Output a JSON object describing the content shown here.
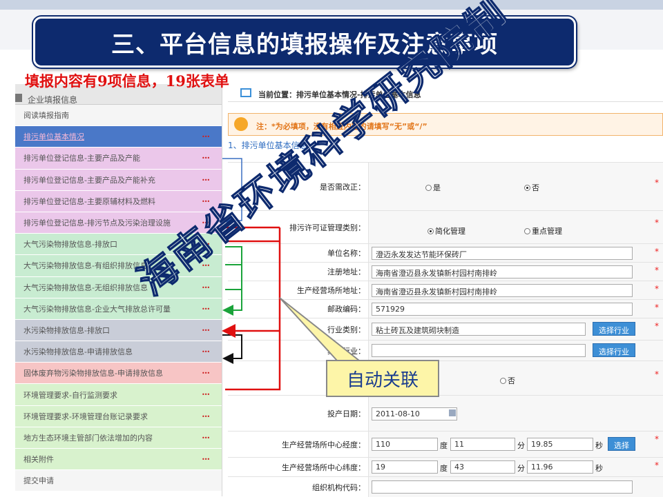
{
  "slide": {
    "title": "三、平台信息的填报操作及注意事项",
    "subtitle": "填报内容有9项信息，19张表单",
    "callout": "自动关联",
    "watermark": "海南省环境科学研究院制"
  },
  "sidebar": {
    "header": "企业填报信息",
    "items": [
      {
        "label": "阅读填报指南",
        "color": "plain"
      },
      {
        "label": "排污单位基本情况",
        "color": "active"
      },
      {
        "label": "排污单位登记信息-主要产品及产能",
        "color": "pink"
      },
      {
        "label": "排污单位登记信息-主要产品及产能补充",
        "color": "pink"
      },
      {
        "label": "排污单位登记信息-主要原辅材料及燃料",
        "color": "pink"
      },
      {
        "label": "排污单位登记信息-排污节点及污染治理设施",
        "color": "pink"
      },
      {
        "label": "大气污染物排放信息-排放口",
        "color": "green"
      },
      {
        "label": "大气污染物排放信息-有组织排放信息",
        "color": "green"
      },
      {
        "label": "大气污染物排放信息-无组织排放信息",
        "color": "green"
      },
      {
        "label": "大气污染物排放信息-企业大气排放总许可量",
        "color": "green"
      },
      {
        "label": "水污染物排放信息-排放口",
        "color": "gray"
      },
      {
        "label": "水污染物排放信息-申请排放信息",
        "color": "gray"
      },
      {
        "label": "固体废弃物污染物排放信息-申请排放信息",
        "color": "red"
      },
      {
        "label": "环境管理要求-自行监测要求",
        "color": "lgreen"
      },
      {
        "label": "环境管理要求-环境管理台账记录要求",
        "color": "lgreen"
      },
      {
        "label": "地方生态环境主管部门依法增加的内容",
        "color": "lgreen"
      },
      {
        "label": "相关附件",
        "color": "lgreen"
      },
      {
        "label": "提交申请",
        "color": "plain"
      }
    ]
  },
  "main": {
    "breadcrumb": "当前位置：排污单位基本情况-排污单位基本信息",
    "notice": "注：*为必填项，没有相应内容的请填写“无”或“/”",
    "section_title": "1、排污单位基本信息",
    "rows": {
      "rectify_label": "是否需改正：",
      "rectify_yes": "是",
      "rectify_no": "否",
      "permit_type_label": "排污许可证管理类别：",
      "permit_simple": "简化管理",
      "permit_key": "重点管理",
      "unit_name_label": "单位名称：",
      "unit_name_value": "澄迈永发发达节能环保砖厂",
      "reg_address_label": "注册地址：",
      "reg_address_value": "海南省澄迈县永发镇新村园村南排岭",
      "site_address_label": "生产经营场所地址：",
      "site_address_value": "海南省澄迈县永发镇新村园村南排岭",
      "postcode_label": "邮政编码：",
      "postcode_value": "571929",
      "industry_label": "行业类别：",
      "industry_value": "粘土砖瓦及建筑砌块制造",
      "select_industry_btn": "选择行业",
      "other_industry_label": "其他行业：",
      "other_industry_value": "",
      "select_industry_btn2": "选择行业",
      "other_no": "否",
      "start_date_label": "投产日期：",
      "start_date_value": "2011-08-10",
      "longitude_label": "生产经营场所中心经度：",
      "lon_deg": "110",
      "lon_min": "11",
      "lon_sec": "19.85",
      "latitude_label": "生产经营场所中心纬度：",
      "lat_deg": "19",
      "lat_min": "43",
      "lat_sec": "11.96",
      "deg_unit": "度",
      "min_unit": "分",
      "sec_unit": "秒",
      "select_btn": "选择",
      "org_code_label": "组织机构代码：",
      "required_mark": "*"
    }
  },
  "colors": {
    "title_bg": "#0d2a6e",
    "subtitle": "#e01010",
    "arrow_red": "#e01010",
    "arrow_green": "#1aa33a",
    "arrow_blue": "#3a6fc2",
    "arrow_black": "#111111",
    "accent_button": "#3d8fd6"
  }
}
